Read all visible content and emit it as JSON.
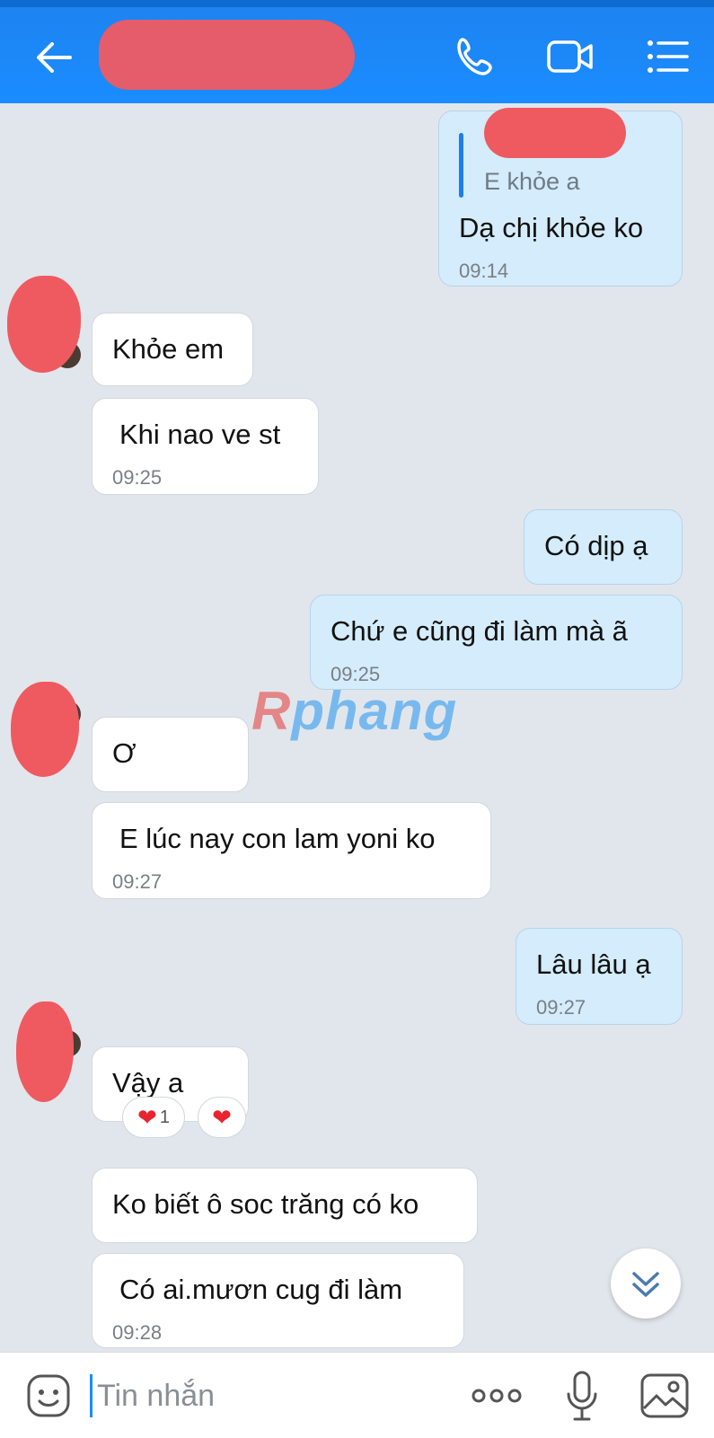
{
  "header": {
    "back_icon": "arrow-left-icon",
    "call_icon": "phone-icon",
    "video_icon": "video-camera-icon",
    "menu_icon": "list-menu-icon",
    "accent": "#1a8cff"
  },
  "messages": [
    {
      "side": "out",
      "quote_text": "E khỏe a",
      "text": "Dạ chị khỏe ko",
      "time": "09:14"
    },
    {
      "side": "in",
      "text": "Khỏe em"
    },
    {
      "side": "in",
      "text": "Khi nao ve st",
      "time": "09:25"
    },
    {
      "side": "out",
      "text": "Có dịp ạ"
    },
    {
      "side": "out",
      "text": "Chứ e cũng đi làm mà ã",
      "time": "09:25"
    },
    {
      "side": "in",
      "text": "Ơ"
    },
    {
      "side": "in",
      "text": "E lúc nay con lam yoni ko",
      "time": "09:27"
    },
    {
      "side": "out",
      "text": "Lâu lâu ạ",
      "time": "09:27"
    },
    {
      "side": "in",
      "text": "Vậy a",
      "reaction_count": "1"
    },
    {
      "side": "in",
      "text": "Ko biết ô soc trăng có ko"
    },
    {
      "side": "in",
      "text": "Có ai.mươn cug đi làm",
      "time": "09:28"
    }
  ],
  "watermark": {
    "first": "R",
    "rest": "phang"
  },
  "composer": {
    "placeholder": "Tin nhắn",
    "emoji_icon": "sticker-smiley-icon",
    "more_icon": "more-dots-icon",
    "mic_icon": "microphone-icon",
    "image_icon": "image-icon"
  }
}
